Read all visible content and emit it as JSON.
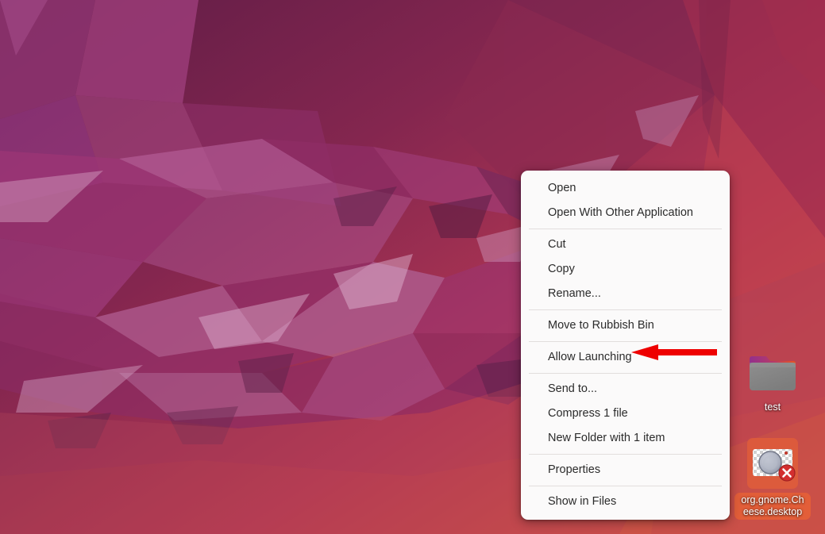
{
  "desktop": {
    "wallpaper_name": "ubuntu-focal-fossa-wallpaper",
    "colors": {
      "wallpaper_dark_purple": "#5b1b45",
      "wallpaper_magenta": "#9b2c53",
      "wallpaper_red": "#c53f4f",
      "wallpaper_orange": "#d85a42",
      "selection_orange": "#e86236",
      "menu_background": "#fbfafa",
      "menu_text": "#2b2b2b",
      "menu_separator": "#e2dedd",
      "annotation_red": "#ee0000",
      "icon_label_text": "#ffffff"
    },
    "icons": [
      {
        "id": "test",
        "label": "test",
        "icon_name": "folder-icon",
        "selected": false,
        "emblem": null
      },
      {
        "id": "cheese-desktop",
        "label": "org.gnome.Cheese.desktop",
        "icon_name": "camera-icon",
        "selected": true,
        "emblem": "error-x-emblem"
      }
    ]
  },
  "context_menu": {
    "name": "desktop-file-context-menu",
    "groups": [
      {
        "items": [
          {
            "label": "Open",
            "name": "menu-item-open"
          },
          {
            "label": "Open With Other Application",
            "name": "menu-item-open-with-other-application"
          }
        ]
      },
      {
        "items": [
          {
            "label": "Cut",
            "name": "menu-item-cut"
          },
          {
            "label": "Copy",
            "name": "menu-item-copy"
          },
          {
            "label": "Rename...",
            "name": "menu-item-rename"
          }
        ]
      },
      {
        "items": [
          {
            "label": "Move to Rubbish Bin",
            "name": "menu-item-move-to-rubbish-bin"
          }
        ]
      },
      {
        "items": [
          {
            "label": "Allow Launching",
            "name": "menu-item-allow-launching"
          }
        ]
      },
      {
        "items": [
          {
            "label": "Send to...",
            "name": "menu-item-send-to"
          },
          {
            "label": "Compress 1 file",
            "name": "menu-item-compress-1-file"
          },
          {
            "label": "New Folder with 1 item",
            "name": "menu-item-new-folder-with-1-item"
          }
        ]
      },
      {
        "items": [
          {
            "label": "Properties",
            "name": "menu-item-properties"
          }
        ]
      },
      {
        "items": [
          {
            "label": "Show in Files",
            "name": "menu-item-show-in-files"
          }
        ]
      }
    ]
  },
  "annotation": {
    "name": "red-arrow-annotation",
    "points_to": "Allow Launching",
    "direction": "left",
    "color": "#ee0000"
  }
}
